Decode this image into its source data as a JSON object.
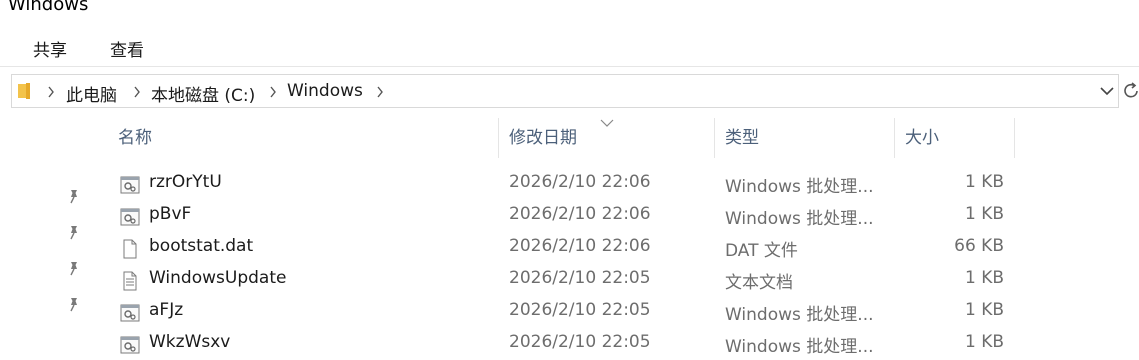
{
  "window": {
    "title": "Windows"
  },
  "ribbon": {
    "tabs": [
      {
        "label": "共享"
      },
      {
        "label": "查看"
      }
    ]
  },
  "address": {
    "crumbs": [
      {
        "label": "此电脑"
      },
      {
        "label": "本地磁盘 (C:)"
      },
      {
        "label": "Windows"
      }
    ]
  },
  "columns": {
    "name": "名称",
    "date": "修改日期",
    "type": "类型",
    "size": "大小"
  },
  "sort": {
    "column": "date",
    "direction": "descending"
  },
  "files": [
    {
      "name": "rzrOrYtU",
      "date": "2026/2/10 22:06",
      "type": "Windows 批处理...",
      "size": "1 KB",
      "icon": "batch-file-icon"
    },
    {
      "name": "pBvF",
      "date": "2026/2/10 22:06",
      "type": "Windows 批处理...",
      "size": "1 KB",
      "icon": "batch-file-icon"
    },
    {
      "name": "bootstat.dat",
      "date": "2026/2/10 22:06",
      "type": "DAT 文件",
      "size": "66 KB",
      "icon": "blank-file-icon"
    },
    {
      "name": "WindowsUpdate",
      "date": "2026/2/10 22:05",
      "type": "文本文档",
      "size": "1 KB",
      "icon": "text-file-icon"
    },
    {
      "name": "aFJz",
      "date": "2026/2/10 22:05",
      "type": "Windows 批处理...",
      "size": "1 KB",
      "icon": "batch-file-icon"
    },
    {
      "name": "WkzWsxv",
      "date": "2026/2/10 22:05",
      "type": "Windows 批处理...",
      "size": "1 KB",
      "icon": "batch-file-icon"
    }
  ]
}
